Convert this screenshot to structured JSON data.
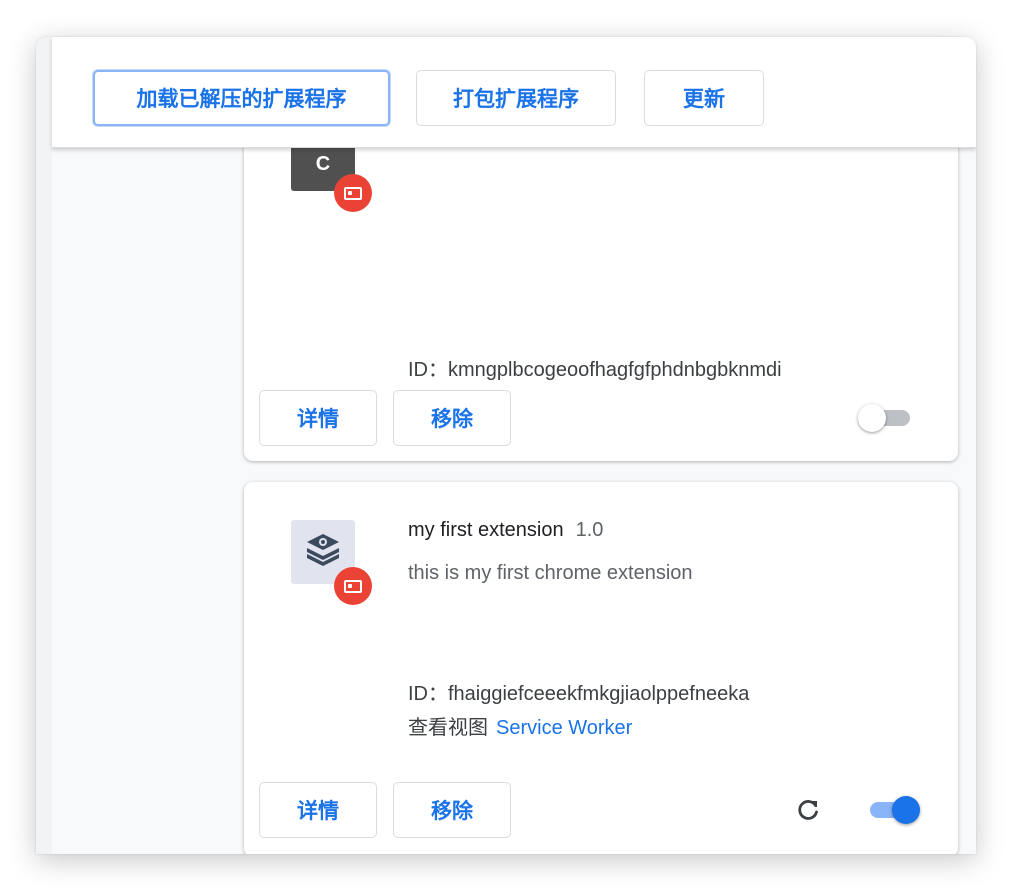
{
  "colors": {
    "accent": "#1a73e8",
    "badge": "#ea4335",
    "toggle_off_track": "#bdc1c6",
    "toggle_on_track": "#8ab4f8"
  },
  "toolbar": {
    "load_unpacked_label": "加载已解压的扩展程序",
    "pack_extension_label": "打包扩展程序",
    "update_label": "更新"
  },
  "extensions": [
    {
      "icon": "letter-c-icon",
      "icon_letter": "C",
      "id_label": "ID：",
      "id": "kmngplbcogeoofhagfgfphdnbgbknmdi",
      "details_label": "详情",
      "remove_label": "移除",
      "enabled": false
    },
    {
      "icon": "stack-layers-icon",
      "name": "my first extension",
      "version": "1.0",
      "description": "this is my first chrome extension",
      "id_label": "ID：",
      "id": "fhaiggiefceeekfmkgjiaolppefneeka",
      "inspect_views_label": "查看视图",
      "inspect_views_link": "Service Worker",
      "details_label": "详情",
      "remove_label": "移除",
      "reload_icon": "reload-icon",
      "enabled": true
    }
  ]
}
